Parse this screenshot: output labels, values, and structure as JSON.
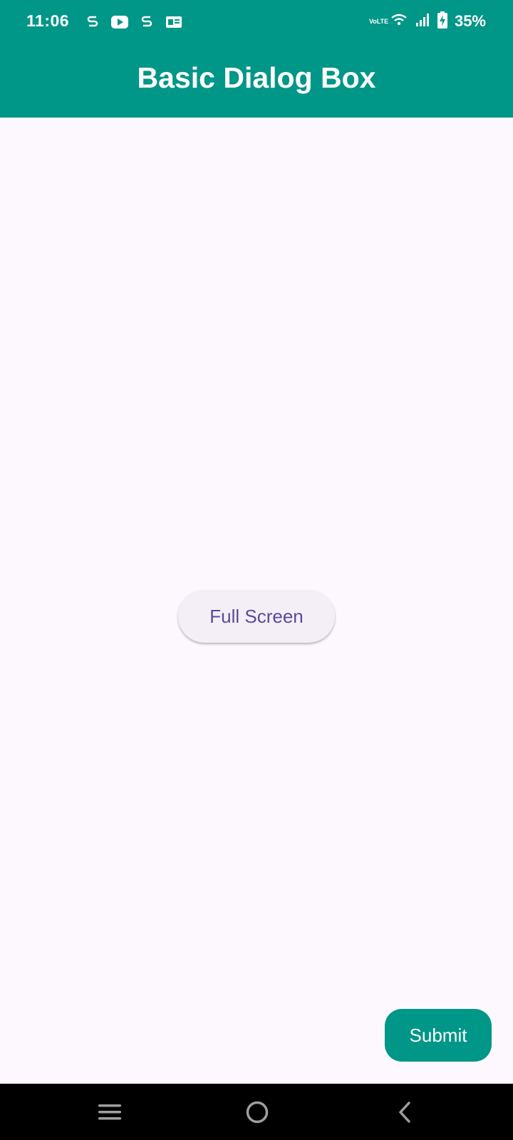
{
  "status_bar": {
    "time": "11:06",
    "left_icons": [
      "s-badge-icon",
      "youtube-icon",
      "s-badge-icon",
      "ge-news-icon"
    ],
    "network_label": "VoLTE",
    "right_icons": [
      "volte-icon",
      "wifi-icon",
      "signal-icon",
      "battery-charging-icon"
    ],
    "battery_percent": "35%"
  },
  "app_bar": {
    "title": "Basic Dialog Box",
    "color": "#009688"
  },
  "main": {
    "full_screen_button_label": "Full Screen",
    "button_text_color": "#5a4a9a"
  },
  "fab": {
    "label": "Submit",
    "color": "#009688"
  },
  "nav_bar": {
    "items": [
      "recent-apps-icon",
      "home-icon",
      "back-icon"
    ]
  }
}
